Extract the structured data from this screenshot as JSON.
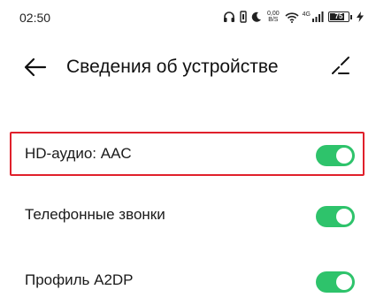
{
  "status_bar": {
    "time": "02:50",
    "net_speed_value": "0,00",
    "net_speed_unit": "B/S",
    "network_type": "4G",
    "battery_level": "75",
    "icons": [
      "headphones-icon",
      "vibrate-icon",
      "moon-icon",
      "wifi-icon",
      "signal-icon",
      "battery-icon",
      "charging-icon"
    ]
  },
  "header": {
    "title": "Сведения об устройстве",
    "back_icon": "back-arrow-icon",
    "edit_icon": "edit-pencil-icon"
  },
  "settings": [
    {
      "label": "HD-аудио: AAC",
      "enabled": true,
      "highlighted": true
    },
    {
      "label": "Телефонные звонки",
      "enabled": true,
      "highlighted": false
    },
    {
      "label": "Профиль A2DP",
      "enabled": true,
      "highlighted": false
    }
  ],
  "colors": {
    "toggle_on": "#2ec36b",
    "highlight_border": "#e0202b",
    "background": "#ffffff",
    "text": "#111111"
  }
}
